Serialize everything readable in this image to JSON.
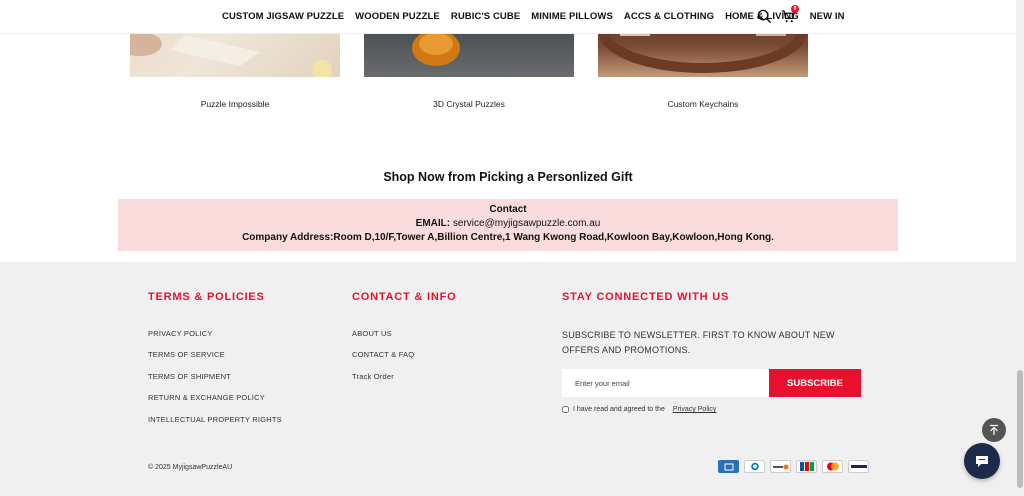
{
  "header": {
    "nav": [
      "CUSTOM JIGSAW PUZZLE",
      "WOODEN PUZZLE",
      "RUBIC'S CUBE",
      "MINIME PILLOWS",
      "ACCS & CLOTHING",
      "HOME & LIVING",
      "NEW IN"
    ],
    "cart_count": "0",
    "icons": [
      "search-icon",
      "cart-icon"
    ]
  },
  "categories": [
    {
      "label": "Puzzle Impossible"
    },
    {
      "label": "3D Crystal Puzzles"
    },
    {
      "label": "Custom Keychains"
    }
  ],
  "shop_now": "Shop Now from Picking a Personlized Gift",
  "contact": {
    "title": "Contact",
    "email_label": "EMAIL:",
    "email": "service@myjigsawpuzzle.com.au",
    "address": "Company Address:Room D,10/F,Tower A,Billion Centre,1 Wang Kwong Road,Kowloon Bay,Kowloon,Hong Kong."
  },
  "footer": {
    "terms_heading": "TERMS & POLICIES",
    "terms_links": [
      "PRIVACY POLICY",
      "TERMS OF SERVICE",
      "TERMS OF SHIPMENT",
      "RETURN & EXCHANGE POLICY",
      "INTELLECTUAL PROPERTY RIGHTS"
    ],
    "contact_heading": "CONTACT & INFO",
    "contact_links": [
      "ABOUT US",
      "CONTACT & FAQ",
      "Track Order"
    ],
    "stay_heading": "STAY CONNECTED WITH US",
    "subscribe_text": "SUBSCRIBE TO NEWSLETTER. FIRST TO KNOW ABOUT NEW OFFERS AND PROMOTIONS.",
    "email_placeholder": "Enter your email",
    "subscribe_button": "SUBSCRIBE",
    "agree_text": "I have read and agreed to the",
    "privacy_link": "Privacy Policy",
    "copyright": "© 2025 MyjigsawPuzzleAU",
    "payments": [
      "AMEX",
      "DINERS",
      "DISCOVER",
      "JCB",
      "MASTERCARD",
      "VISA"
    ]
  },
  "colors": {
    "accent": "#e8112d",
    "contact_bg": "#fbdcdc",
    "footer_bg": "#f0f0f0",
    "chat_bg": "#1d2b4a"
  }
}
